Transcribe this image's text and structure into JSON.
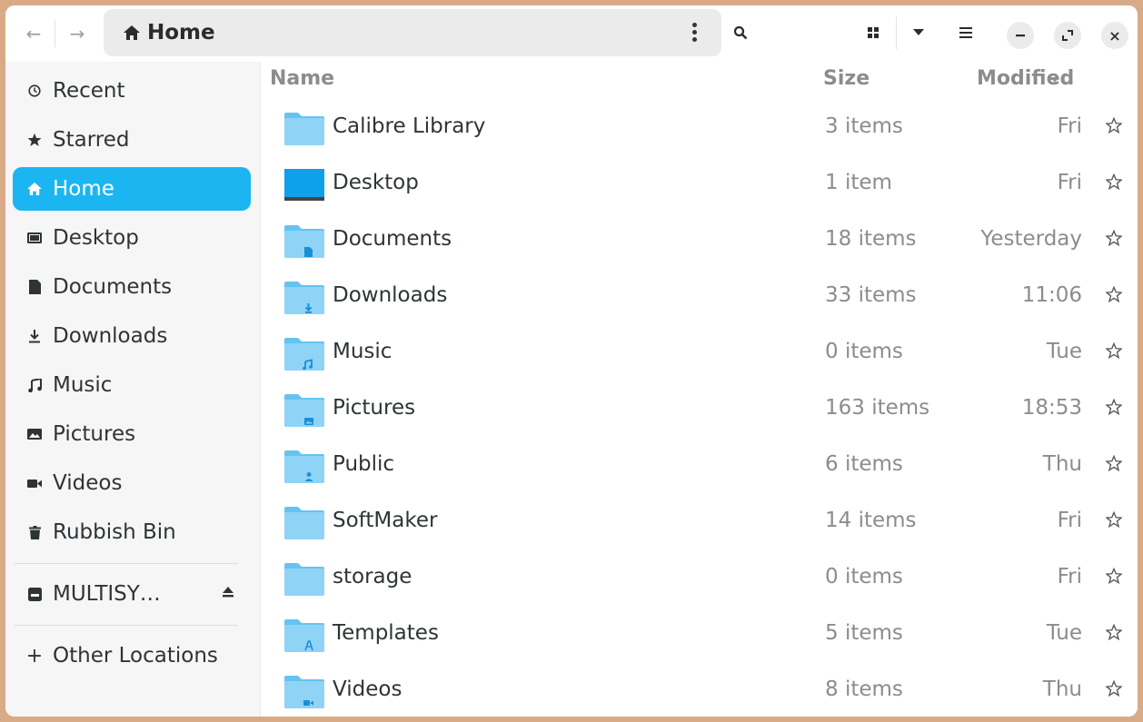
{
  "header": {
    "back_icon": "←",
    "forward_icon": "→",
    "location": "Home",
    "close_glyph": "×"
  },
  "sidebar": {
    "items": [
      {
        "label": "Recent",
        "icon": "clock-icon"
      },
      {
        "label": "Starred",
        "icon": "star-icon"
      },
      {
        "label": "Home",
        "icon": "home-icon",
        "active": true
      },
      {
        "label": "Desktop",
        "icon": "desktop-icon"
      },
      {
        "label": "Documents",
        "icon": "document-icon"
      },
      {
        "label": "Downloads",
        "icon": "download-icon"
      },
      {
        "label": "Music",
        "icon": "music-icon"
      },
      {
        "label": "Pictures",
        "icon": "picture-icon"
      },
      {
        "label": "Videos",
        "icon": "video-icon"
      },
      {
        "label": "Rubbish Bin",
        "icon": "trash-icon"
      }
    ],
    "drive": {
      "label": "MULTISY…",
      "icon": "drive-icon"
    },
    "other_locations": "Other Locations"
  },
  "columns": {
    "name": "Name",
    "size": "Size",
    "modified": "Modified"
  },
  "files": [
    {
      "name": "Calibre Library",
      "size": "3 items",
      "modified": "Fri",
      "emblem": "none"
    },
    {
      "name": "Desktop",
      "size": "1 item",
      "modified": "Fri",
      "emblem": "desktop"
    },
    {
      "name": "Documents",
      "size": "18 items",
      "modified": "Yesterday",
      "emblem": "document"
    },
    {
      "name": "Downloads",
      "size": "33 items",
      "modified": "11:06",
      "emblem": "download"
    },
    {
      "name": "Music",
      "size": "0 items",
      "modified": "Tue",
      "emblem": "music"
    },
    {
      "name": "Pictures",
      "size": "163 items",
      "modified": "18:53",
      "emblem": "picture"
    },
    {
      "name": "Public",
      "size": "6 items",
      "modified": "Thu",
      "emblem": "person"
    },
    {
      "name": "SoftMaker",
      "size": "14 items",
      "modified": "Fri",
      "emblem": "none"
    },
    {
      "name": "storage",
      "size": "0 items",
      "modified": "Fri",
      "emblem": "none"
    },
    {
      "name": "Templates",
      "size": "5 items",
      "modified": "Tue",
      "emblem": "template"
    },
    {
      "name": "Videos",
      "size": "8 items",
      "modified": "Thu",
      "emblem": "video"
    }
  ],
  "colors": {
    "accent": "#1bb6f2",
    "folder": "#8fd3f7",
    "folder_tab": "#65c3f0"
  }
}
